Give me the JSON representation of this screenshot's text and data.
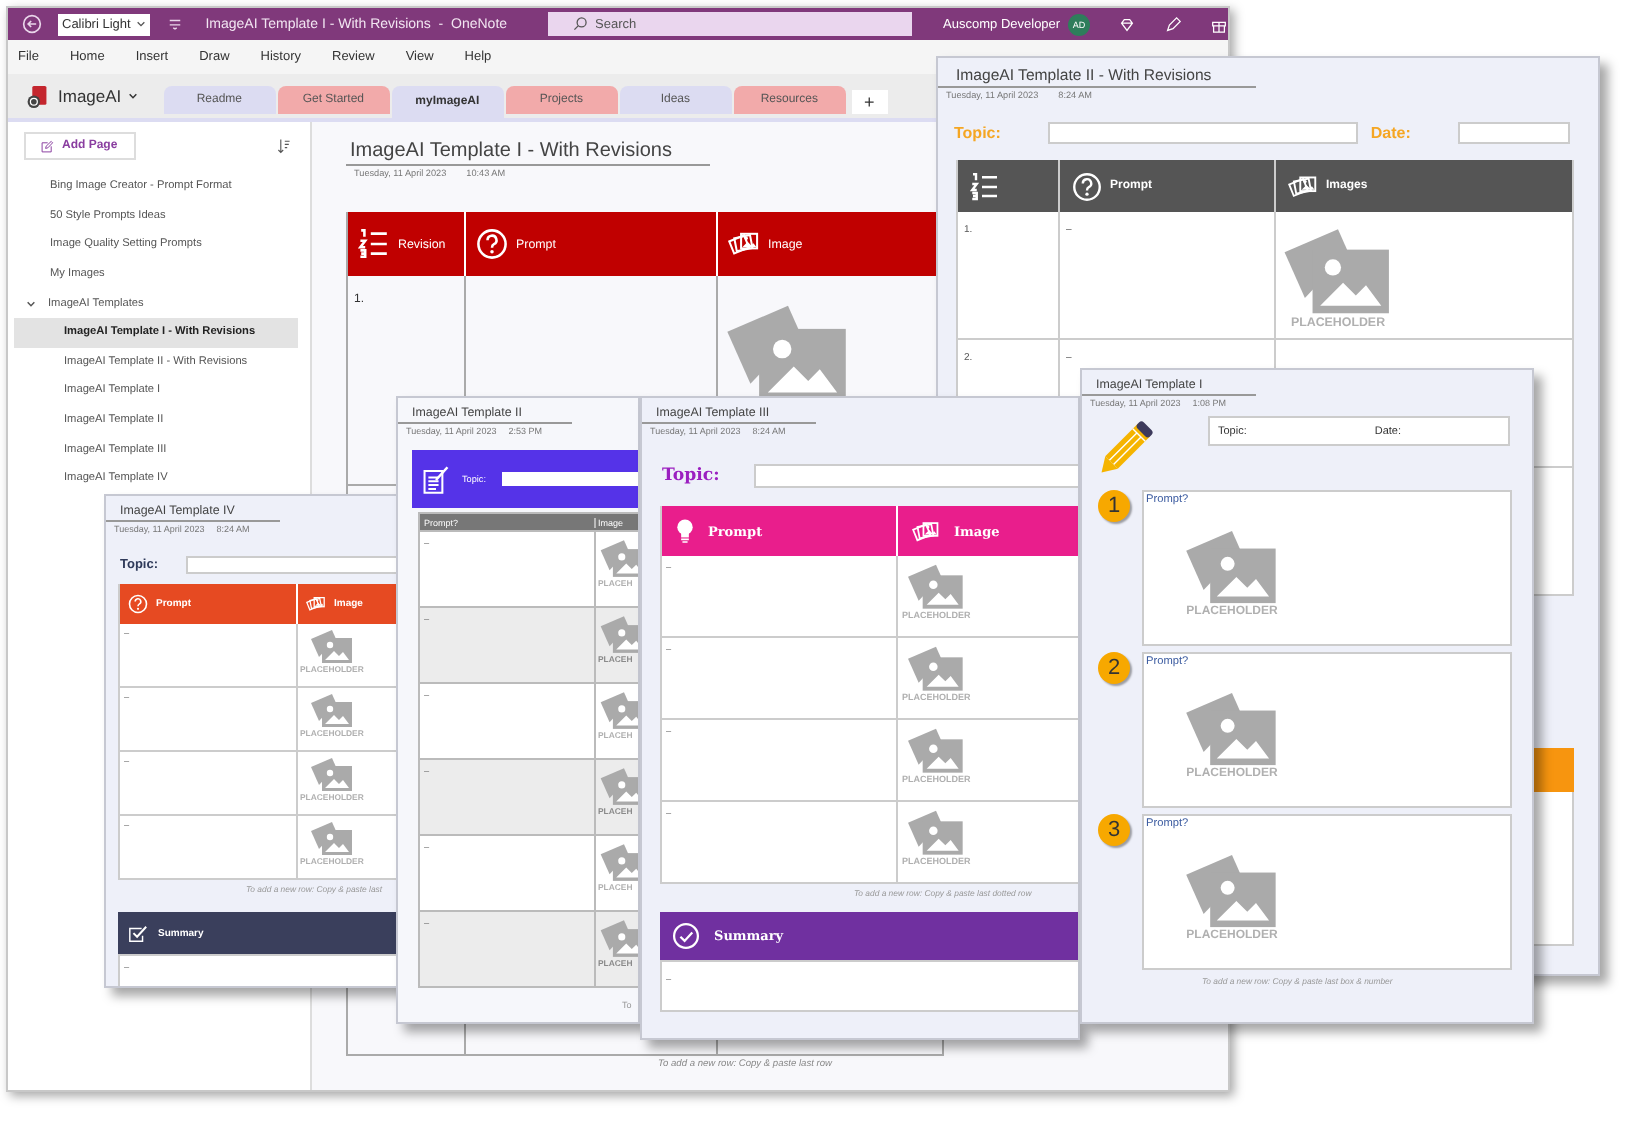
{
  "title_bar": {
    "font_box": "Calibri Light",
    "title": "ImageAI Template I - With Revisions  -  OneNote",
    "search_placeholder": "Search",
    "user": "Auscomp Developer",
    "avatar": "AD"
  },
  "menu": [
    "File",
    "Home",
    "Insert",
    "Draw",
    "History",
    "Review",
    "View",
    "Help"
  ],
  "notebook": {
    "name": "ImageAI"
  },
  "section_tabs": [
    {
      "label": "Readme",
      "color": "#dcdcf2",
      "selected": false
    },
    {
      "label": "Get Started",
      "color": "#f2aaaa",
      "selected": false
    },
    {
      "label": "myImageAI",
      "color": "#dcdcf2",
      "selected": true
    },
    {
      "label": "Projects",
      "color": "#f2aaaa",
      "selected": false
    },
    {
      "label": "Ideas",
      "color": "#dcdcf2",
      "selected": false
    },
    {
      "label": "Resources",
      "color": "#f2aaaa",
      "selected": false
    }
  ],
  "add_section": "+",
  "sidebar": {
    "add_page": "Add Page",
    "pages": [
      {
        "title": "Bing Image Creator - Prompt Format",
        "selected": false
      },
      {
        "title": "50 Style Prompts Ideas",
        "selected": false
      },
      {
        "title": "Image Quality Setting Prompts",
        "selected": false
      },
      {
        "title": "My Images",
        "selected": false
      },
      {
        "title": "ImageAI Templates",
        "selected": false,
        "expanded": true,
        "children": [
          {
            "title": "ImageAI Template I - With Revisions",
            "selected": true
          },
          {
            "title": "ImageAI Template II - With Revisions",
            "selected": false
          },
          {
            "title": "ImageAI Template I",
            "selected": false
          },
          {
            "title": "ImageAI Template II",
            "selected": false
          },
          {
            "title": "ImageAI Template III",
            "selected": false
          },
          {
            "title": "ImageAI Template IV",
            "selected": false
          }
        ]
      }
    ]
  },
  "page": {
    "title": "ImageAI Template I - With Revisions",
    "date": "Tuesday, 11 April 2023",
    "time": "10:43 AM",
    "columns": [
      "Revision",
      "Prompt",
      "Image"
    ],
    "rows": [
      {
        "number": "1."
      }
    ],
    "footer": "To add a new row: Copy & paste last row"
  },
  "template_ii_revisions": {
    "title": "ImageAI Template II - With Revisions",
    "date": "Tuesday, 11 April 2023",
    "time": "8:24 AM",
    "topic_label": "Topic:",
    "date_label": "Date:",
    "columns": [
      "Prompt",
      "Images"
    ],
    "rows": [
      {
        "number": "1.",
        "prompt": "–",
        "image_label": "PLACEHOLDER"
      },
      {
        "number": "2.",
        "prompt": "–"
      }
    ]
  },
  "template_iv": {
    "title": "ImageAI Template IV",
    "date": "Tuesday, 11 April 2023",
    "time": "8:24 AM",
    "topic_label": "Topic:",
    "columns": [
      "Prompt",
      "Image"
    ],
    "rows": [
      {
        "prompt": "–",
        "image_label": "PLACEHOLDER"
      },
      {
        "prompt": "–",
        "image_label": "PLACEHOLDER"
      },
      {
        "prompt": "–",
        "image_label": "PLACEHOLDER"
      },
      {
        "prompt": "–",
        "image_label": "PLACEHOLDER"
      }
    ],
    "footer": "To add a new row: Copy & paste last",
    "summary": "Summary",
    "summary_text": "–"
  },
  "template_ii": {
    "title": "ImageAI Template II",
    "date": "Tuesday, 11 April 2023",
    "time": "2:53 PM",
    "topic_label": "Topic:",
    "columns": [
      "Prompt?",
      "Image"
    ],
    "rows": [
      {
        "prompt": "–",
        "image_label": "PLACEH"
      },
      {
        "prompt": "–",
        "image_label": "PLACEH"
      },
      {
        "prompt": "–",
        "image_label": "PLACEH"
      },
      {
        "prompt": "–",
        "image_label": "PLACEH"
      },
      {
        "prompt": "–",
        "image_label": "PLACEH"
      },
      {
        "prompt": "–",
        "image_label": "PLACEH"
      }
    ],
    "footer": "To"
  },
  "template_iii": {
    "title": "ImageAI Template III",
    "date": "Tuesday, 11 April 2023",
    "time": "8:24 AM",
    "topic_label": "Topic:",
    "columns": [
      "Prompt",
      "Image"
    ],
    "rows": [
      {
        "prompt": "–",
        "image_label": "PLACEHOLDER"
      },
      {
        "prompt": "–",
        "image_label": "PLACEHOLDER"
      },
      {
        "prompt": "–",
        "image_label": "PLACEHOLDER"
      },
      {
        "prompt": "–",
        "image_label": "PLACEHOLDER"
      }
    ],
    "footer": "To add a new row: Copy & paste last dotted row",
    "summary": "Summary",
    "summary_text": "–"
  },
  "template_i": {
    "title": "ImageAI Template I",
    "date": "Tuesday, 11 April 2023",
    "time": "1:08 PM",
    "topic_label": "Topic:",
    "date_label": "Date:",
    "boxes": [
      {
        "number": "1",
        "prompt": "Prompt?",
        "image_label": "PLACEHOLDER"
      },
      {
        "number": "2",
        "prompt": "Prompt?",
        "image_label": "PLACEHOLDER"
      },
      {
        "number": "3",
        "prompt": "Prompt?",
        "image_label": "PLACEHOLDER"
      }
    ],
    "footer": "To add a new row: Copy & paste last box & number"
  }
}
